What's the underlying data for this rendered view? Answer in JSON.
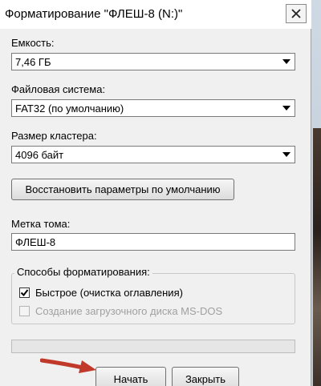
{
  "window": {
    "title": "Форматирование \"ФЛЕШ-8 (N:)\""
  },
  "capacity": {
    "label": "Емкость:",
    "value": "7,46 ГБ"
  },
  "filesystem": {
    "label": "Файловая система:",
    "value": "FAT32 (по умолчанию)"
  },
  "cluster": {
    "label": "Размер кластера:",
    "value": "4096 байт"
  },
  "restore_defaults_label": "Восстановить параметры по умолчанию",
  "volume": {
    "label": "Метка тома:",
    "value": "ФЛЕШ-8"
  },
  "format_options": {
    "title": "Способы форматирования:",
    "quick": {
      "label": "Быстрое (очистка оглавления)",
      "checked": true
    },
    "msdos": {
      "label": "Создание загрузочного диска MS-DOS",
      "checked": false,
      "disabled": true
    }
  },
  "progress": {
    "fraction": 0
  },
  "buttons": {
    "start": "Начать",
    "close": "Закрыть"
  },
  "colors": {
    "annotation_arrow": "#c0392b",
    "progress_fill": "#06b025"
  },
  "icons": {
    "close": "close-icon",
    "dropdown": "chevron-down-icon",
    "check": "checkmark-icon",
    "annotation": "arrow-annotation-icon"
  }
}
